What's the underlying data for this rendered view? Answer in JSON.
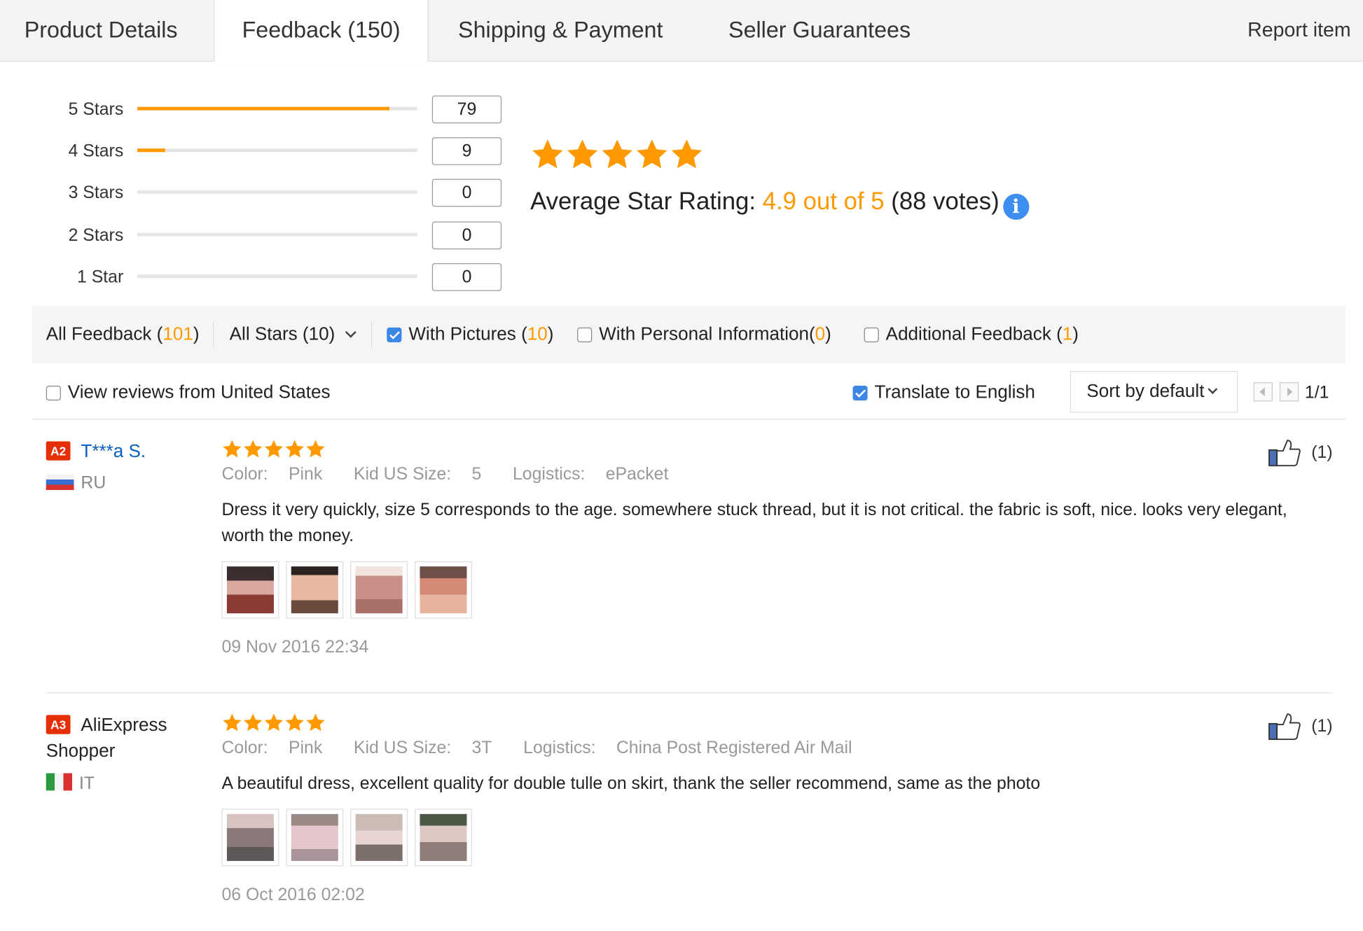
{
  "tabs": [
    {
      "label": "Product Details"
    },
    {
      "label": "Feedback (150)"
    },
    {
      "label": "Shipping & Payment"
    },
    {
      "label": "Seller Guarantees"
    }
  ],
  "report_label": "Report item",
  "ratings": [
    {
      "label": "5 Stars",
      "count": "79",
      "fraction": 0.9
    },
    {
      "label": "4 Stars",
      "count": "9",
      "fraction": 0.1
    },
    {
      "label": "3 Stars",
      "count": "0",
      "fraction": 0
    },
    {
      "label": "2 Stars",
      "count": "0",
      "fraction": 0
    },
    {
      "label": "1 Star",
      "count": "0",
      "fraction": 0
    }
  ],
  "average": {
    "label": "Average Star Rating:",
    "value": "4.9 out of 5",
    "votes": "(88 votes)",
    "stars": 5
  },
  "filters": {
    "all_feedback_label": "All Feedback (",
    "all_feedback_count": "101",
    "all_stars": "All Stars (10)",
    "with_pictures_label": "With Pictures (",
    "with_pictures_count": "10",
    "personal_label": "With Personal Information(",
    "personal_count": "0",
    "additional_label": "Additional Feedback (",
    "additional_count": "1",
    "close_paren": ")"
  },
  "options": {
    "view_us": "View reviews from United States",
    "translate": "Translate to English",
    "sort": "Sort by default",
    "page": "1/1"
  },
  "colors": {
    "accent": "#ff9900",
    "link": "#0a5fbf",
    "level_badge": "#e62e04",
    "checkbox": "#3a87e6"
  },
  "reviews": [
    {
      "level": "A2",
      "user": "T***a S.",
      "country": "RU",
      "stars": 5,
      "color_label": "Color:",
      "color": "Pink",
      "size_label": "Kid US Size:",
      "size": "5",
      "logistics_label": "Logistics:",
      "logistics": "ePacket",
      "text": "Dress it very quickly, size 5 corresponds to the age. somewhere stuck thread, but it is not critical. the fabric is soft, nice. looks very elegant, worth the money.",
      "likes": "(1)",
      "date": "09 Nov 2016 22:34"
    },
    {
      "level": "A3",
      "user": "AliExpress Shopper",
      "country": "IT",
      "stars": 5,
      "color_label": "Color:",
      "color": "Pink",
      "size_label": "Kid US Size:",
      "size": "3T",
      "logistics_label": "Logistics:",
      "logistics": "China Post Registered Air Mail",
      "text": "A beautiful dress, excellent quality for double tulle on skirt, thank the seller recommend, same as the photo",
      "likes": "(1)",
      "date": "06 Oct 2016 02:02"
    }
  ]
}
